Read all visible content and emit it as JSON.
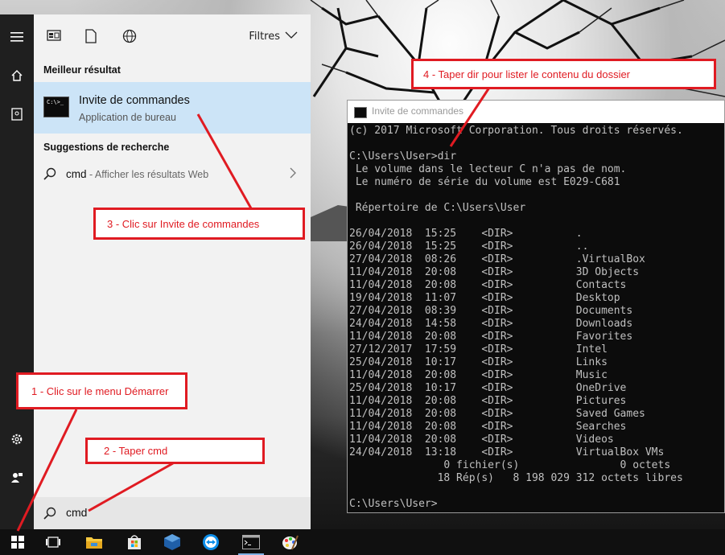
{
  "start_menu": {
    "filters_label": "Filtres",
    "best_header": "Meilleur résultat",
    "best_result": {
      "title": "Invite de commandes",
      "subtitle": "Application de bureau"
    },
    "suggestions_header": "Suggestions de recherche",
    "suggestion": {
      "term": "cmd",
      "hint": " - Afficher les résultats Web"
    },
    "search_value": "cmd",
    "tile_glyph": "C:\\>_"
  },
  "cmd_window": {
    "title": "Invite de commandes",
    "lines": [
      "(c) 2017 Microsoft Corporation. Tous droits réservés.",
      "",
      "C:\\Users\\User>dir",
      " Le volume dans le lecteur C n'a pas de nom.",
      " Le numéro de série du volume est E029-C681",
      "",
      " Répertoire de C:\\Users\\User",
      "",
      "26/04/2018  15:25    <DIR>          .",
      "26/04/2018  15:25    <DIR>          ..",
      "27/04/2018  08:26    <DIR>          .VirtualBox",
      "11/04/2018  20:08    <DIR>          3D Objects",
      "11/04/2018  20:08    <DIR>          Contacts",
      "19/04/2018  11:07    <DIR>          Desktop",
      "27/04/2018  08:39    <DIR>          Documents",
      "24/04/2018  14:58    <DIR>          Downloads",
      "11/04/2018  20:08    <DIR>          Favorites",
      "27/12/2017  17:59    <DIR>          Intel",
      "25/04/2018  10:17    <DIR>          Links",
      "11/04/2018  20:08    <DIR>          Music",
      "25/04/2018  10:17    <DIR>          OneDrive",
      "11/04/2018  20:08    <DIR>          Pictures",
      "11/04/2018  20:08    <DIR>          Saved Games",
      "11/04/2018  20:08    <DIR>          Searches",
      "11/04/2018  20:08    <DIR>          Videos",
      "24/04/2018  13:18    <DIR>          VirtualBox VMs",
      "               0 fichier(s)                0 octets",
      "              18 Rép(s)   8 198 029 312 octets libres",
      "",
      "C:\\Users\\User>"
    ]
  },
  "annotations": {
    "step1": "1 - Clic sur le menu Démarrer",
    "step2": "2 - Taper cmd",
    "step3": "3 - Clic sur Invite de commandes",
    "step4": "4 - Taper dir pour lister le contenu du dossier"
  },
  "colors": {
    "accent_red": "#e01b22",
    "selection_blue": "#cce4f7",
    "console_text": "#c0c0c0"
  },
  "icons": {
    "strip": [
      "hamburger-icon",
      "home-icon",
      "contact-card-icon",
      "settings-gear-icon",
      "user-feedback-icon"
    ],
    "toolbar": [
      "apps-icon",
      "documents-icon",
      "web-globe-icon",
      "chevron-down-icon"
    ],
    "taskbar": [
      "windows-start-icon",
      "task-view-icon",
      "file-explorer-icon",
      "store-icon",
      "virtualbox-icon",
      "teamviewer-icon",
      "cmd-icon",
      "paint-icon"
    ]
  }
}
